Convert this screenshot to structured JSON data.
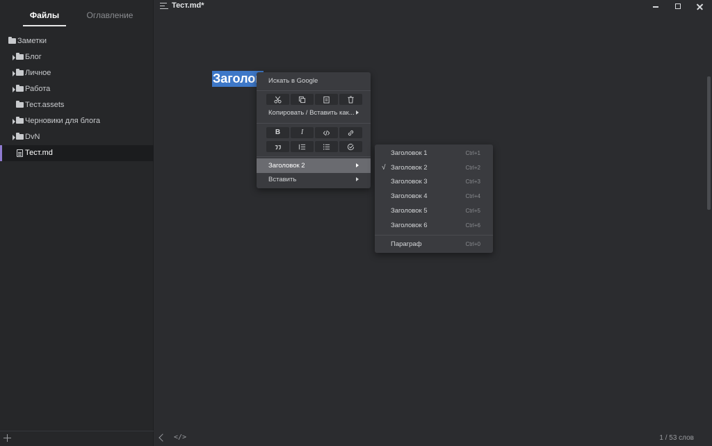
{
  "sidebar": {
    "tabs": [
      {
        "label": "Файлы",
        "active": true
      },
      {
        "label": "Оглавление",
        "active": false
      }
    ],
    "tree": [
      {
        "label": "Заметки",
        "type": "folder",
        "expandable": false
      },
      {
        "label": "Блог",
        "type": "folder",
        "expandable": true
      },
      {
        "label": "Личное",
        "type": "folder",
        "expandable": true
      },
      {
        "label": "Работа",
        "type": "folder",
        "expandable": true
      },
      {
        "label": "Тест.assets",
        "type": "folder",
        "expandable": false
      },
      {
        "label": "Черновики для блога",
        "type": "folder",
        "expandable": true
      },
      {
        "label": "DvN",
        "type": "folder",
        "expandable": true
      },
      {
        "label": "Тест.md",
        "type": "file",
        "selected": true
      }
    ]
  },
  "titlebar": {
    "doc_title": "Тест.md*"
  },
  "editor": {
    "selected_heading": "Заголов",
    "word_count": "1 / 53 слов",
    "code_toggle": "</>"
  },
  "context_menu": {
    "search_google": "Искать в Google",
    "copy_paste_as": "Копировать / Вставить как...",
    "heading": "Заголовок 2",
    "insert": "Вставить",
    "format_buttons": [
      "B",
      "I"
    ]
  },
  "heading_submenu": {
    "items": [
      {
        "label": "Заголовок 1",
        "shortcut": "Ctrl+1",
        "checked": false
      },
      {
        "label": "Заголовок 2",
        "shortcut": "Ctrl+2",
        "checked": true
      },
      {
        "label": "Заголовок 3",
        "shortcut": "Ctrl+3",
        "checked": false
      },
      {
        "label": "Заголовок 4",
        "shortcut": "Ctrl+4",
        "checked": false
      },
      {
        "label": "Заголовок 5",
        "shortcut": "Ctrl+5",
        "checked": false
      },
      {
        "label": "Заголовок 6",
        "shortcut": "Ctrl+6",
        "checked": false
      }
    ],
    "paragraph": {
      "label": "Параграф",
      "shortcut": "Ctrl+0"
    },
    "check_mark": "√"
  },
  "colors": {
    "background": "#2b2c2f",
    "sidebar": "#262729",
    "selection": "#3e78c8",
    "selected_accent": "#8f7bd0",
    "menu": "#3a3b3f",
    "menu_highlight": "#6a6b70"
  }
}
